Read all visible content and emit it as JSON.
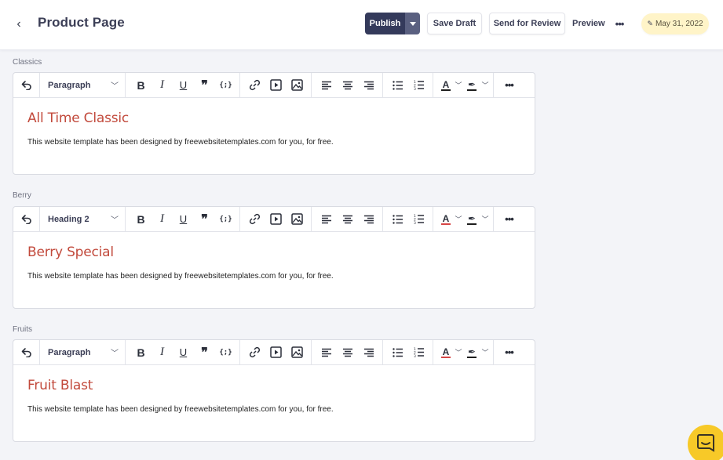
{
  "header": {
    "back_icon": "chevron-left-icon",
    "title": "Product Page",
    "publish_label": "Publish",
    "save_draft_label": "Save Draft",
    "send_review_label": "Send for Review",
    "preview_label": "Preview",
    "more_label": "•••",
    "date_label": "May 31, 2022"
  },
  "colors": {
    "primary": "#343a5b",
    "heading_red": "#c24a3c",
    "date_badge_bg": "#fff4c8",
    "chat_yellow": "#f7c928"
  },
  "sections": [
    {
      "label": "Classics",
      "format": "Paragraph",
      "heading": "All Time Classic",
      "body": "This website template has been designed by freewebsitetemplates.com for you, for free."
    },
    {
      "label": "Berry",
      "format": "Heading 2",
      "heading": "Berry Special",
      "body": "This website template has been designed by freewebsitetemplates.com for you, for free."
    },
    {
      "label": "Fruits",
      "format": "Paragraph",
      "heading": "Fruit Blast",
      "body": "This website template has been designed by freewebsitetemplates.com for you, for free."
    }
  ],
  "toolbar": {
    "bold": "B",
    "italic": "I",
    "underline": "U",
    "quote": "❞",
    "code": "{;}",
    "text_color": "A",
    "more": "•••"
  }
}
